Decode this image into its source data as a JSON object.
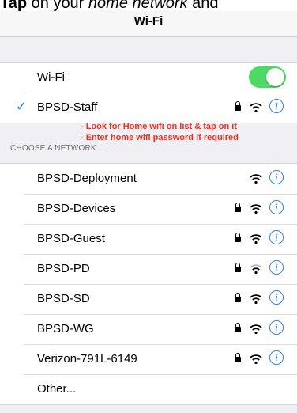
{
  "banner": {
    "bold": "Tap",
    "middle": " on your ",
    "italic": "home network",
    "end": " and"
  },
  "nav": {
    "title": "Wi-Fi"
  },
  "wifi_toggle": {
    "label": "Wi-Fi",
    "on": true
  },
  "connected": {
    "name": "BPSD-Staff"
  },
  "annotations": {
    "line1": "- Look for Home wifi on list & tap on it",
    "line2": "- Enter home wifi password if required"
  },
  "section_header": "CHOOSE A NETWORK...",
  "networks": [
    {
      "name": "BPSD-Deployment",
      "locked": false
    },
    {
      "name": "BPSD-Devices",
      "locked": true
    },
    {
      "name": "BPSD-Guest",
      "locked": true
    },
    {
      "name": "BPSD-PD",
      "locked": true
    },
    {
      "name": "BPSD-SD",
      "locked": true
    },
    {
      "name": "BPSD-WG",
      "locked": true
    },
    {
      "name": "Verizon-791L-6149",
      "locked": true
    }
  ],
  "other": {
    "label": "Other..."
  },
  "colors": {
    "accent": "#2d7ff9",
    "toggle_on": "#4cd964",
    "annotation": "#ff2a1a"
  },
  "icons": {
    "lock": "lock-icon",
    "wifi": "wifi-icon",
    "info": "info-icon",
    "check": "checkmark-icon"
  }
}
